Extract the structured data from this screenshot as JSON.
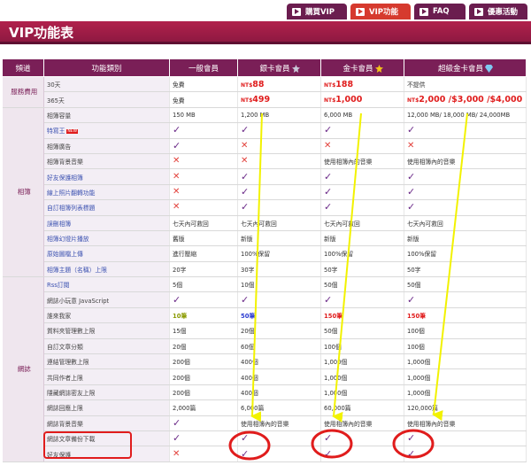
{
  "tabs": [
    {
      "label": "購買VIP",
      "active": false
    },
    {
      "label": "VIP功能",
      "active": true
    },
    {
      "label": "FAQ",
      "active": false
    },
    {
      "label": "優惠活動",
      "active": false
    }
  ],
  "page_title": "VIP功能表",
  "columns": [
    "頻道",
    "功能類別",
    "一般會員",
    "銀卡會員",
    "金卡會員",
    "超級金卡會員"
  ],
  "groups": [
    {
      "name": "服務費用",
      "rows": [
        {
          "feature": "30天",
          "link": false,
          "new": false,
          "cells": [
            {
              "t": "text",
              "v": "免費"
            },
            {
              "t": "price",
              "v": "88"
            },
            {
              "t": "price",
              "v": "188"
            },
            {
              "t": "text",
              "v": "不提供"
            }
          ]
        },
        {
          "feature": "365天",
          "link": false,
          "new": false,
          "cells": [
            {
              "t": "text",
              "v": "免費"
            },
            {
              "t": "price",
              "v": "499"
            },
            {
              "t": "price",
              "v": "1,000"
            },
            {
              "t": "price",
              "v": "2,000 /$3,000 /$4,000"
            }
          ]
        }
      ]
    },
    {
      "name": "相簿",
      "rows": [
        {
          "feature": "相簿容量",
          "link": false,
          "new": false,
          "cells": [
            {
              "t": "text",
              "v": "150 MB"
            },
            {
              "t": "text",
              "v": "1,200 MB"
            },
            {
              "t": "text",
              "v": "6,000 MB"
            },
            {
              "t": "text",
              "v": "12,000 MB/ 18,000 MB/ 24,000MB"
            }
          ]
        },
        {
          "feature": "特寫王",
          "link": true,
          "new": true,
          "cells": [
            {
              "t": "check"
            },
            {
              "t": "check"
            },
            {
              "t": "check"
            },
            {
              "t": "check"
            }
          ]
        },
        {
          "feature": "相簿廣告",
          "link": false,
          "new": false,
          "cells": [
            {
              "t": "check"
            },
            {
              "t": "cross"
            },
            {
              "t": "cross"
            },
            {
              "t": "cross"
            }
          ]
        },
        {
          "feature": "相簿背景音樂",
          "link": false,
          "new": false,
          "cells": [
            {
              "t": "cross"
            },
            {
              "t": "cross"
            },
            {
              "t": "text",
              "v": "使用相簿內的音樂"
            },
            {
              "t": "text",
              "v": "使用相簿內的音樂"
            }
          ]
        },
        {
          "feature": "好友保護相簿",
          "link": true,
          "new": false,
          "cells": [
            {
              "t": "cross"
            },
            {
              "t": "check"
            },
            {
              "t": "check"
            },
            {
              "t": "check"
            }
          ]
        },
        {
          "feature": "線上照片翻轉功能",
          "link": true,
          "new": false,
          "cells": [
            {
              "t": "cross"
            },
            {
              "t": "check"
            },
            {
              "t": "check"
            },
            {
              "t": "check"
            }
          ]
        },
        {
          "feature": "自訂相簿列表標題",
          "link": true,
          "new": false,
          "cells": [
            {
              "t": "cross"
            },
            {
              "t": "check"
            },
            {
              "t": "check"
            },
            {
              "t": "check"
            }
          ]
        },
        {
          "feature": "誤刪相簿",
          "link": true,
          "new": false,
          "cells": [
            {
              "t": "text",
              "v": "七天內可救回"
            },
            {
              "t": "text",
              "v": "七天內可救回"
            },
            {
              "t": "text",
              "v": "七天內可救回"
            },
            {
              "t": "text",
              "v": "七天內可救回"
            }
          ]
        },
        {
          "feature": "相簿幻燈片播放",
          "link": true,
          "new": false,
          "cells": [
            {
              "t": "text",
              "v": "舊版"
            },
            {
              "t": "text",
              "v": "新版"
            },
            {
              "t": "text",
              "v": "新版"
            },
            {
              "t": "text",
              "v": "新版"
            }
          ]
        },
        {
          "feature": "原始圖檔上傳",
          "link": true,
          "new": false,
          "cells": [
            {
              "t": "text",
              "v": "進行壓縮"
            },
            {
              "t": "text",
              "v": "100%保留"
            },
            {
              "t": "text",
              "v": "100%保留"
            },
            {
              "t": "text",
              "v": "100%保留"
            }
          ]
        },
        {
          "feature": "相簿主題（名稱）上限",
          "link": true,
          "new": false,
          "cells": [
            {
              "t": "text",
              "v": "20字"
            },
            {
              "t": "text",
              "v": "30字"
            },
            {
              "t": "text",
              "v": "50字"
            },
            {
              "t": "text",
              "v": "50字"
            }
          ]
        }
      ]
    },
    {
      "name": "網誌",
      "rows": [
        {
          "feature": "Rss訂閱",
          "link": true,
          "new": false,
          "cells": [
            {
              "t": "text",
              "v": "5個"
            },
            {
              "t": "text",
              "v": "10個"
            },
            {
              "t": "text",
              "v": "50個"
            },
            {
              "t": "text",
              "v": "50個"
            }
          ]
        },
        {
          "feature": "網誌小玩意 JavaScript",
          "link": false,
          "new": false,
          "cells": [
            {
              "t": "check"
            },
            {
              "t": "check"
            },
            {
              "t": "check"
            },
            {
              "t": "check"
            }
          ]
        },
        {
          "feature": "誰來我家",
          "link": false,
          "new": false,
          "cells": [
            {
              "t": "olive",
              "v": "10筆"
            },
            {
              "t": "blue",
              "v": "50筆"
            },
            {
              "t": "red",
              "v": "150筆"
            },
            {
              "t": "red",
              "v": "150筆"
            }
          ]
        },
        {
          "feature": "質料夾管理數上限",
          "link": false,
          "new": false,
          "cells": [
            {
              "t": "text",
              "v": "15個"
            },
            {
              "t": "text",
              "v": "20個"
            },
            {
              "t": "text",
              "v": "50個"
            },
            {
              "t": "text",
              "v": "100個"
            }
          ]
        },
        {
          "feature": "自訂文章分類",
          "link": false,
          "new": false,
          "cells": [
            {
              "t": "text",
              "v": "20個"
            },
            {
              "t": "text",
              "v": "60個"
            },
            {
              "t": "text",
              "v": "100個"
            },
            {
              "t": "text",
              "v": "100個"
            }
          ]
        },
        {
          "feature": "連結管理數上限",
          "link": false,
          "new": false,
          "cells": [
            {
              "t": "text",
              "v": "200個"
            },
            {
              "t": "text",
              "v": "400個"
            },
            {
              "t": "text",
              "v": "1,000個"
            },
            {
              "t": "text",
              "v": "1,000個"
            }
          ]
        },
        {
          "feature": "共同作者上限",
          "link": false,
          "new": false,
          "cells": [
            {
              "t": "text",
              "v": "200個"
            },
            {
              "t": "text",
              "v": "400個"
            },
            {
              "t": "text",
              "v": "1,000個"
            },
            {
              "t": "text",
              "v": "1,000個"
            }
          ]
        },
        {
          "feature": "隱藏網誌密友上限",
          "link": false,
          "new": false,
          "cells": [
            {
              "t": "text",
              "v": "200個"
            },
            {
              "t": "text",
              "v": "400個"
            },
            {
              "t": "text",
              "v": "1,000個"
            },
            {
              "t": "text",
              "v": "1,000個"
            }
          ]
        },
        {
          "feature": "網誌回應上限",
          "link": false,
          "new": false,
          "cells": [
            {
              "t": "text",
              "v": "2,000篇"
            },
            {
              "t": "text",
              "v": "6,000篇"
            },
            {
              "t": "text",
              "v": "60,000篇"
            },
            {
              "t": "text",
              "v": "120,000篇"
            }
          ]
        },
        {
          "feature": "網誌背景音樂",
          "link": false,
          "new": false,
          "cells": [
            {
              "t": "check"
            },
            {
              "t": "text",
              "v": "使用相簿內的音樂"
            },
            {
              "t": "text",
              "v": "使用相簿內的音樂"
            },
            {
              "t": "text",
              "v": "使用相簿內的音樂"
            }
          ]
        },
        {
          "feature": "網誌文章備份下載",
          "link": false,
          "new": false,
          "cells": [
            {
              "t": "check"
            },
            {
              "t": "check"
            },
            {
              "t": "check"
            },
            {
              "t": "check"
            }
          ]
        },
        {
          "feature": "好友保護",
          "link": false,
          "new": false,
          "cells": [
            {
              "t": "cross"
            },
            {
              "t": "check"
            },
            {
              "t": "check"
            },
            {
              "t": "check"
            }
          ]
        }
      ]
    }
  ],
  "currency": "NT$",
  "new_badge": "NEW",
  "colors": {
    "brand": "#7a1f57",
    "active_tab": "#d63a2e",
    "price": "#e01c1c",
    "annotation_arrow": "#f2f200",
    "annotation_circle": "#e01c1c"
  }
}
